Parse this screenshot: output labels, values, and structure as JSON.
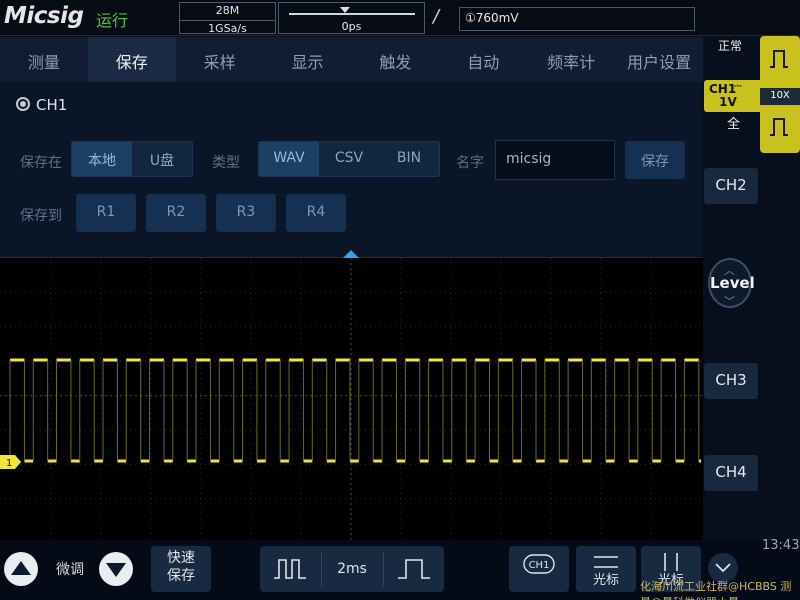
{
  "topbar": {
    "logo": "Micsig",
    "run_state": "运行",
    "memory_depth": "28M",
    "sample_rate": "1GSa/s",
    "trigger_position": "0ps",
    "trigger_edge_symbol": "/",
    "trigger_level": "①760mV"
  },
  "right": {
    "trigger_status": "正常",
    "ch1_name": "CH1",
    "ch1_coupling_symbol": "⎓",
    "ch1_scale": "1V",
    "ch1_bandwidth": "全",
    "probe_ratio": "10X",
    "ch2_label": "CH2",
    "ch3_label": "CH3",
    "ch4_label": "CH4",
    "level_label": "Level",
    "clock": "13:43",
    "colors": {
      "ch1": "#c9c21e",
      "trace": "#f0e63a",
      "accent": "#3ca1dc",
      "run": "#4ec24e"
    }
  },
  "menu": {
    "tabs": [
      "测量",
      "保存",
      "采样",
      "显示",
      "触发",
      "自动",
      "频率计",
      "用户设置"
    ],
    "active": "保存"
  },
  "save_panel": {
    "source_label": "CH1",
    "save_in_label": "保存在",
    "locations": [
      "本地",
      "U盘"
    ],
    "location_selected": "本地",
    "type_label": "类型",
    "types": [
      "WAV",
      "CSV",
      "BIN"
    ],
    "type_selected": "WAV",
    "name_label": "名字",
    "name_value": "micsig",
    "save_button": "保存",
    "save_to_label": "保存到",
    "refs": [
      "R1",
      "R2",
      "R3",
      "R4"
    ]
  },
  "waveform": {
    "channel_marker": "1",
    "signal_type": "square",
    "high_level_v": 1.0,
    "low_level_v": 0.0,
    "pulse_count_visible": 30
  },
  "bottom": {
    "fine_label": "微调",
    "quick_save_line1": "快速",
    "quick_save_line2": "保存",
    "timebase": "2ms",
    "ch1_chip": "CH1",
    "cursor_label": "光标",
    "cursor_label2": "光标",
    "watermark": "化海川流工业社群@HCBBS 测量@曼科做仪器小曼"
  }
}
